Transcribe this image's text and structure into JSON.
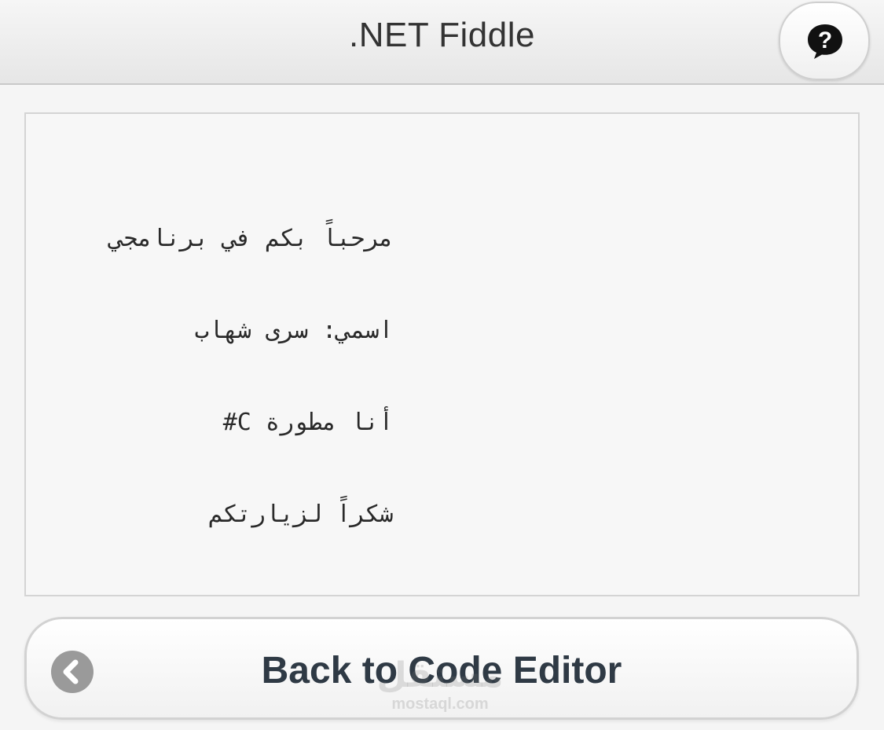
{
  "header": {
    "title": ".NET Fiddle",
    "help_icon": "question-speech-bubble-icon"
  },
  "output": {
    "lines": [
      "مرحباً بكم في برنامجي",
      "اسمي: سرى شهاب",
      "أنا مطورة C#",
      "شكراً لزيارتكم"
    ]
  },
  "back_button": {
    "label": "Back to Code Editor",
    "icon": "chevron-left-circle-icon"
  },
  "watermark": {
    "arabic": "مستقل",
    "domain": "mostaql.com"
  },
  "colors": {
    "background": "#f5f5f5",
    "header_bg": "#e6e6e6",
    "title_text": "#333333",
    "button_text": "#2f3a45",
    "back_icon_bg": "#9a9a9a"
  }
}
